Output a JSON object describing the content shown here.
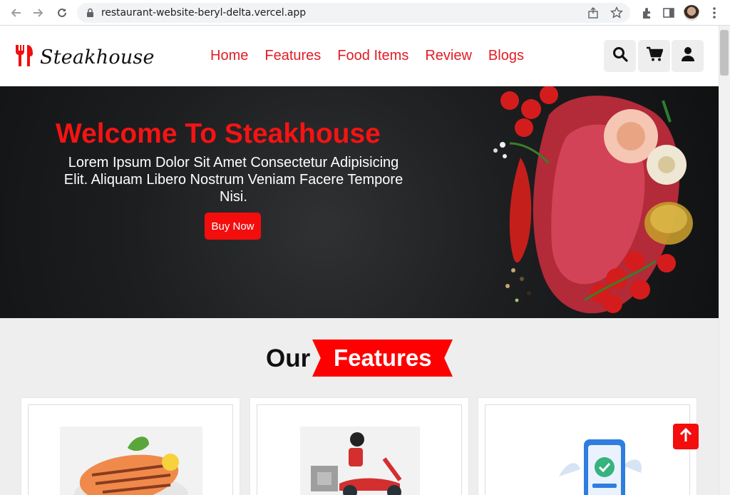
{
  "browser": {
    "url": "restaurant-website-beryl-delta.vercel.app"
  },
  "header": {
    "logo_text": "Steakhouse",
    "nav": [
      "Home",
      "Features",
      "Food Items",
      "Review",
      "Blogs"
    ]
  },
  "hero": {
    "title": "Welcome To Steakhouse",
    "text": "Lorem Ipsum Dolor Sit Amet Consectetur Adipisicing Elit. Aliquam Libero Nostrum Veniam Facere Tempore Nisi.",
    "button": "Buy Now"
  },
  "features_section": {
    "title_our": "Our",
    "title_features": "Features"
  },
  "colors": {
    "accent": "#f40d0d",
    "nav": "#e31c25"
  },
  "icons": [
    "search-icon",
    "cart-icon",
    "user-icon",
    "arrow-up-icon"
  ]
}
